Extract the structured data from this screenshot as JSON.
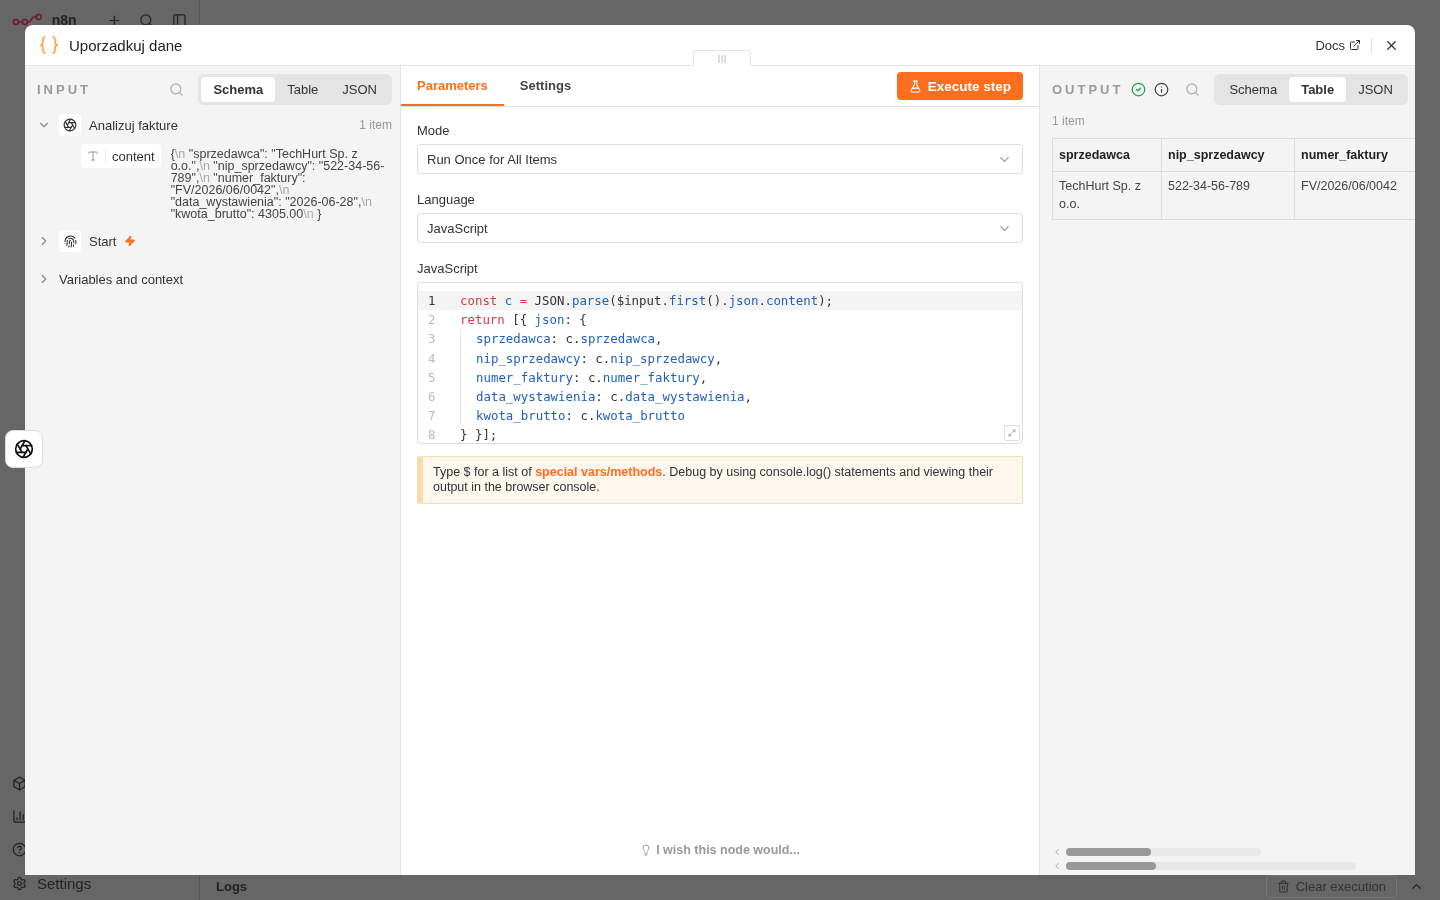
{
  "app": {
    "brand": "n8n",
    "settings": "Settings",
    "logs": "Logs",
    "clear_button": "Clear execution"
  },
  "modal": {
    "title": "Uporzadkuj dane",
    "docs_link": "Docs"
  },
  "input": {
    "heading": "INPUT",
    "view_tabs": [
      {
        "label": "Schema",
        "selected": true
      },
      {
        "label": "Table",
        "selected": false
      },
      {
        "label": "JSON",
        "selected": false
      }
    ],
    "tree": [
      {
        "kind": "node",
        "label": "Analizuj fakture",
        "count": "1 item",
        "expanded": true,
        "children": [
          {
            "kind": "field",
            "label": "content",
            "value_parts": [
              {
                "text": "{",
                "kind": "plain"
              },
              {
                "text": "\\n",
                "kind": "escape"
              },
              {
                "text": " \"sprzedawca\": \"TechHurt Sp. z o.o.\",",
                "kind": "plain"
              },
              {
                "text": "\\n",
                "kind": "escape"
              },
              {
                "text": " \"nip_sprzedawcy\": \"522-34-56-789\",",
                "kind": "plain"
              },
              {
                "text": "\\n",
                "kind": "escape"
              },
              {
                "text": " \"numer_faktury\": \"FV/2026/06/0042\",",
                "kind": "plain"
              },
              {
                "text": "\\n",
                "kind": "escape"
              },
              {
                "text": " \"data_wystawienia\": \"2026-06-28\",",
                "kind": "plain"
              },
              {
                "text": "\\n",
                "kind": "escape"
              },
              {
                "text": " \"kwota_brutto\": 4305.00",
                "kind": "plain"
              },
              {
                "text": "\\n",
                "kind": "escape"
              },
              {
                "text": " }",
                "kind": "plain"
              }
            ]
          }
        ]
      },
      {
        "kind": "trigger",
        "label": "Start",
        "expanded": false
      },
      {
        "kind": "section",
        "label": "Variables and context",
        "expanded": false
      }
    ]
  },
  "parameters": {
    "tabs": [
      {
        "label": "Parameters",
        "selected": true
      },
      {
        "label": "Settings",
        "selected": false
      }
    ],
    "execute_button": "Execute step",
    "fields": [
      {
        "label": "Mode",
        "value": "Run Once for All Items"
      },
      {
        "label": "Language",
        "value": "JavaScript"
      }
    ],
    "code_label": "JavaScript",
    "code_lines": [
      {
        "number": "1",
        "active": true,
        "kind": "top",
        "tokens": [
          {
            "text": "const ",
            "kind": "keyword"
          },
          {
            "text": "c ",
            "kind": "name"
          },
          {
            "text": "= ",
            "kind": "keyword"
          },
          {
            "text": "JSON.",
            "kind": "plain"
          },
          {
            "text": "parse",
            "kind": "name"
          },
          {
            "text": "($input.",
            "kind": "plain"
          },
          {
            "text": "first",
            "kind": "name"
          },
          {
            "text": "().",
            "kind": "plain"
          },
          {
            "text": "json",
            "kind": "name"
          },
          {
            "text": ".",
            "kind": "plain"
          },
          {
            "text": "content",
            "kind": "name"
          },
          {
            "text": ");",
            "kind": "plain"
          }
        ]
      },
      {
        "number": "2",
        "active": false,
        "kind": "top",
        "tokens": [
          {
            "text": "return ",
            "kind": "keyword"
          },
          {
            "text": "[{ ",
            "kind": "plain"
          },
          {
            "text": "json",
            "kind": "name"
          },
          {
            "text": ": {",
            "kind": "plain"
          }
        ]
      },
      {
        "number": "3",
        "active": false,
        "kind": "inner",
        "tokens": [
          {
            "text": "sprzedawca",
            "kind": "name"
          },
          {
            "text": ": c.",
            "kind": "plain"
          },
          {
            "text": "sprzedawca",
            "kind": "name"
          },
          {
            "text": ",",
            "kind": "plain"
          }
        ]
      },
      {
        "number": "4",
        "active": false,
        "kind": "inner",
        "tokens": [
          {
            "text": "nip_sprzedawcy",
            "kind": "name"
          },
          {
            "text": ": c.",
            "kind": "plain"
          },
          {
            "text": "nip_sprzedawcy",
            "kind": "name"
          },
          {
            "text": ",",
            "kind": "plain"
          }
        ]
      },
      {
        "number": "5",
        "active": false,
        "kind": "inner",
        "tokens": [
          {
            "text": "numer_faktury",
            "kind": "name"
          },
          {
            "text": ": c.",
            "kind": "plain"
          },
          {
            "text": "numer_faktury",
            "kind": "name"
          },
          {
            "text": ",",
            "kind": "plain"
          }
        ]
      },
      {
        "number": "6",
        "active": false,
        "kind": "inner",
        "tokens": [
          {
            "text": "data_wystawienia",
            "kind": "name"
          },
          {
            "text": ": c.",
            "kind": "plain"
          },
          {
            "text": "data_wystawienia",
            "kind": "name"
          },
          {
            "text": ",",
            "kind": "plain"
          }
        ]
      },
      {
        "number": "7",
        "active": false,
        "kind": "inner",
        "tokens": [
          {
            "text": "kwota_brutto",
            "kind": "name"
          },
          {
            "text": ": c.",
            "kind": "plain"
          },
          {
            "text": "kwota_brutto",
            "kind": "name"
          }
        ]
      },
      {
        "number": "8",
        "active": false,
        "kind": "top",
        "tokens": [
          {
            "text": "} }];",
            "kind": "plain"
          }
        ]
      }
    ],
    "notice": {
      "before": "Type $ for a list of ",
      "link": "special vars/methods",
      "after": ". Debug by using console.log() statements and viewing their output in the browser console."
    },
    "feedback": "I wish this node would..."
  },
  "output": {
    "heading": "OUTPUT",
    "view_tabs": [
      {
        "label": "Schema",
        "selected": false
      },
      {
        "label": "Table",
        "selected": true
      },
      {
        "label": "JSON",
        "selected": false
      }
    ],
    "count": "1 item",
    "table": {
      "columns": [
        "sprzedawca",
        "nip_sprzedawcy",
        "numer_faktury"
      ],
      "rows": [
        [
          "TechHurt Sp. z o.o.",
          "522-34-56-789",
          "FV/2026/06/0042"
        ]
      ]
    }
  }
}
